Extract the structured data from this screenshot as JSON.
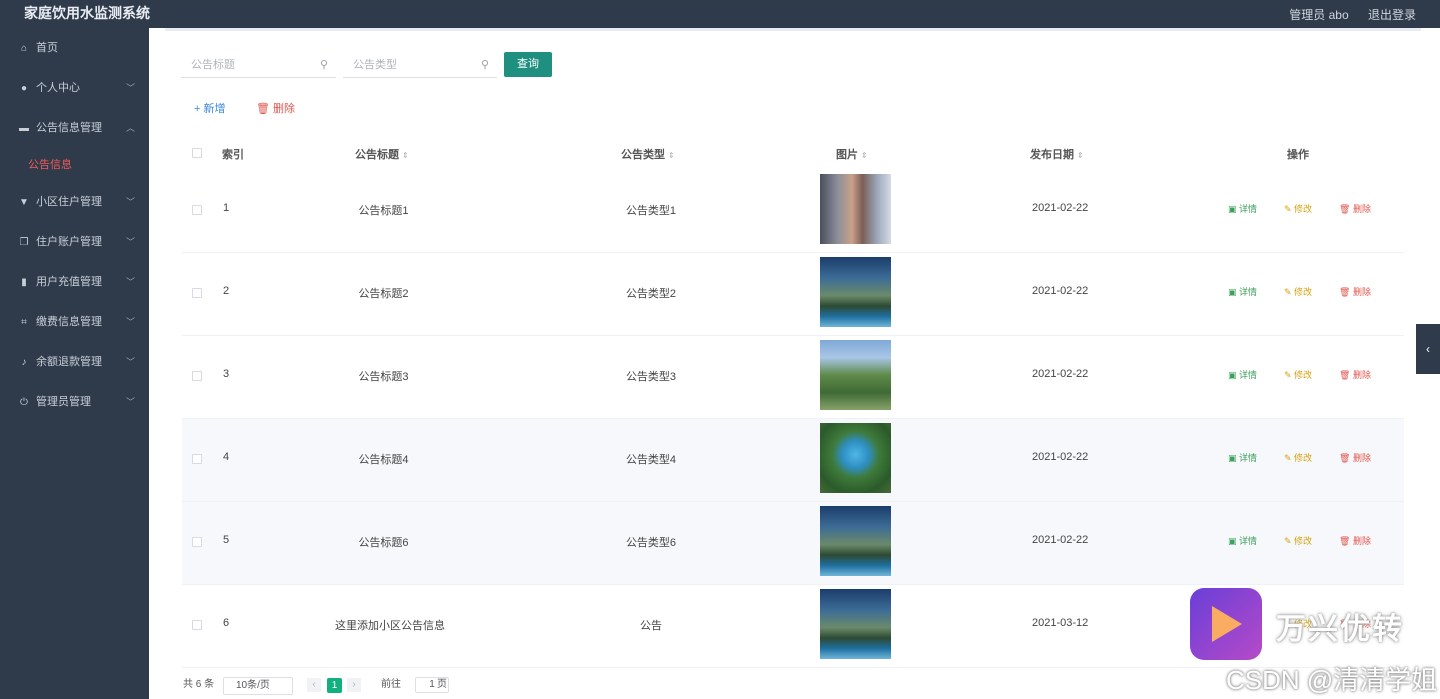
{
  "app": {
    "title": "家庭饮用水监测系统",
    "user_label": "管理员 abo",
    "logout_label": "退出登录"
  },
  "sidebar": {
    "items": [
      {
        "label": "首页",
        "icon": "home-icon",
        "glyph": "⌂",
        "expandable": false
      },
      {
        "label": "个人中心",
        "icon": "user-icon",
        "glyph": "●",
        "expandable": true
      },
      {
        "label": "公告信息管理",
        "icon": "video-icon",
        "glyph": "▬",
        "expandable": true,
        "expanded": true
      },
      {
        "label": "公告信息",
        "icon": "",
        "glyph": "",
        "expandable": false,
        "sub": true,
        "active": true
      },
      {
        "label": "小区住户管理",
        "icon": "comment-icon",
        "glyph": "▼",
        "expandable": true
      },
      {
        "label": "住户账户管理",
        "icon": "copy-icon",
        "glyph": "❐",
        "expandable": true
      },
      {
        "label": "用户充值管理",
        "icon": "chart-icon",
        "glyph": "▮",
        "expandable": true
      },
      {
        "label": "缴费信息管理",
        "icon": "crop-icon",
        "glyph": "⌗",
        "expandable": true
      },
      {
        "label": "余额退款管理",
        "icon": "mic-icon",
        "glyph": "♪",
        "expandable": true
      },
      {
        "label": "管理员管理",
        "icon": "power-icon",
        "glyph": "⏻",
        "expandable": true
      }
    ]
  },
  "search": {
    "title_placeholder": "公告标题",
    "type_placeholder": "公告类型",
    "query_label": "查询"
  },
  "toolbar": {
    "add_label": "+ 新增",
    "delete_label": "删除"
  },
  "table": {
    "headers": {
      "index": "索引",
      "title": "公告标题",
      "type": "公告类型",
      "image": "图片",
      "date": "发布日期",
      "actions": "操作"
    },
    "action_labels": {
      "view": "详情",
      "edit": "修改",
      "delete": "删除"
    },
    "rows": [
      {
        "index": "1",
        "title": "公告标题1",
        "type": "公告类型1",
        "date": "2021-02-22",
        "image": "street-photo"
      },
      {
        "index": "2",
        "title": "公告标题2",
        "type": "公告类型2",
        "date": "2021-02-22",
        "image": "apartment-pool-photo"
      },
      {
        "index": "3",
        "title": "公告标题3",
        "type": "公告类型3",
        "date": "2021-02-22",
        "image": "garden-photo"
      },
      {
        "index": "4",
        "title": "公告标题4",
        "type": "公告类型4",
        "date": "2021-02-22",
        "image": "pool-aerial-photo"
      },
      {
        "index": "5",
        "title": "公告标题6",
        "type": "公告类型6",
        "date": "2021-02-22",
        "image": "apartment-pool-photo"
      },
      {
        "index": "6",
        "title": "这里添加小区公告信息",
        "type": "公告",
        "date": "2021-03-12",
        "image": "apartment-pool-photo"
      }
    ]
  },
  "pagination": {
    "total": "共 6 条",
    "page_size": "10条/页",
    "current": "1",
    "goto_label": "前往",
    "goto_value": "1",
    "page_unit": "页"
  },
  "watermark": {
    "brand": "万兴优转",
    "csdn": "CSDN @清清学姐"
  },
  "colors": {
    "sidebar_bg": "#2f3a4a",
    "primary": "#1f8f7f",
    "danger": "#e0574f",
    "active_menu": "#f15a5a",
    "pager_active": "#12b07e"
  }
}
